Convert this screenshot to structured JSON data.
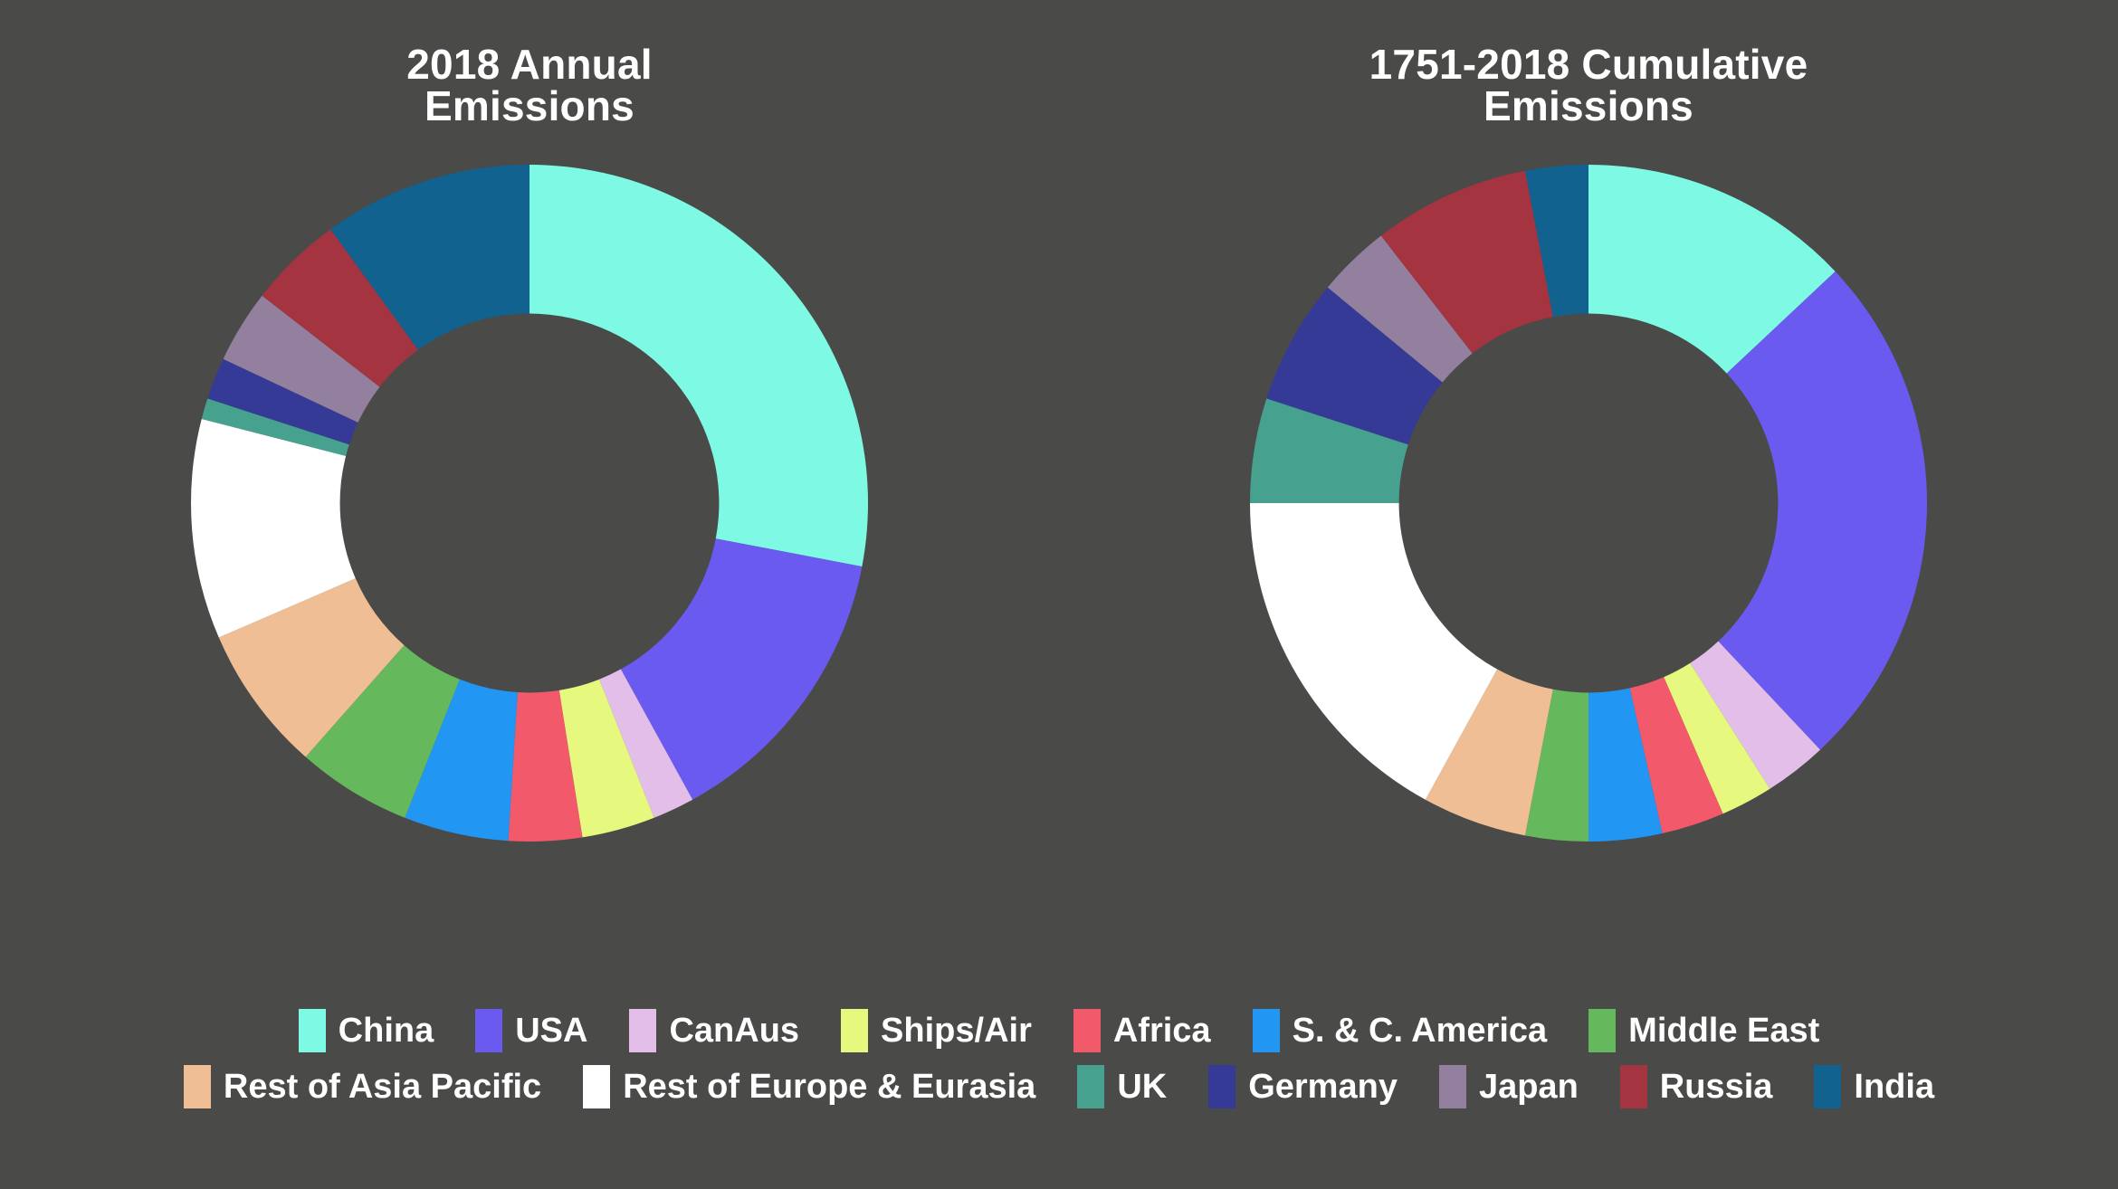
{
  "background_color": "#4a4a48",
  "text_color": "#ffffff",
  "charts": [
    {
      "title": "2018 Annual\nEmissions"
    },
    {
      "title": "1751-2018 Cumulative\nEmissions"
    }
  ],
  "legend": {
    "rows": [
      [
        {
          "label": "China",
          "color": "#7DF9E4"
        },
        {
          "label": "USA",
          "color": "#6A5AF0"
        },
        {
          "label": "CanAus",
          "color": "#E2BEE8"
        },
        {
          "label": "Ships/Air",
          "color": "#E6F97E"
        },
        {
          "label": "Africa",
          "color": "#F2596B"
        },
        {
          "label": "S. & C. America",
          "color": "#2196F3"
        },
        {
          "label": "Middle East",
          "color": "#66B85C"
        }
      ],
      [
        {
          "label": "Rest of Asia Pacific",
          "color": "#EFBE95"
        },
        {
          "label": "Rest of Europe & Eurasia",
          "color": "#FFFFFF"
        },
        {
          "label": "UK",
          "color": "#46A18F"
        },
        {
          "label": "Germany",
          "color": "#353A96"
        },
        {
          "label": "Japan",
          "color": "#93809F"
        },
        {
          "label": "Russia",
          "color": "#A33440"
        },
        {
          "label": "India",
          "color": "#11628F"
        }
      ]
    ]
  },
  "chart_data": [
    {
      "type": "pie",
      "variant": "donut",
      "title": "2018 Annual Emissions",
      "units": "percent of total",
      "start_angle_deg": 0,
      "direction": "clockwise",
      "inner_radius_ratio": 0.56,
      "categories": [
        "China",
        "USA",
        "CanAus",
        "Ships/Air",
        "Africa",
        "S. & C. America",
        "Middle East",
        "Rest of Asia Pacific",
        "Rest of Europe & Eurasia",
        "UK",
        "Germany",
        "Japan",
        "Russia",
        "India"
      ],
      "values": [
        28.0,
        14.0,
        2.0,
        3.5,
        3.5,
        5.0,
        5.5,
        7.0,
        10.5,
        1.0,
        2.0,
        3.5,
        4.5,
        10.0
      ],
      "colors": [
        "#7DF9E4",
        "#6A5AF0",
        "#E2BEE8",
        "#E6F97E",
        "#F2596B",
        "#2196F3",
        "#66B85C",
        "#EFBE95",
        "#FFFFFF",
        "#46A18F",
        "#353A96",
        "#93809F",
        "#A33440",
        "#11628F"
      ],
      "legend_position": "bottom",
      "grid": false
    },
    {
      "type": "pie",
      "variant": "donut",
      "title": "1751-2018 Cumulative Emissions",
      "units": "percent of total",
      "start_angle_deg": 0,
      "direction": "clockwise",
      "inner_radius_ratio": 0.56,
      "categories": [
        "China",
        "USA",
        "CanAus",
        "Ships/Air",
        "Africa",
        "S. & C. America",
        "Middle East",
        "Rest of Asia Pacific",
        "Rest of Europe & Eurasia",
        "UK",
        "Germany",
        "Japan",
        "Russia",
        "India"
      ],
      "values": [
        13.0,
        25.0,
        3.0,
        2.5,
        3.0,
        3.5,
        3.0,
        5.0,
        17.0,
        5.0,
        6.0,
        3.5,
        7.5,
        3.0
      ],
      "colors": [
        "#7DF9E4",
        "#6A5AF0",
        "#E2BEE8",
        "#E6F97E",
        "#F2596B",
        "#2196F3",
        "#66B85C",
        "#EFBE95",
        "#FFFFFF",
        "#46A18F",
        "#353A96",
        "#93809F",
        "#A33440",
        "#11628F"
      ],
      "legend_position": "bottom",
      "grid": false
    }
  ]
}
